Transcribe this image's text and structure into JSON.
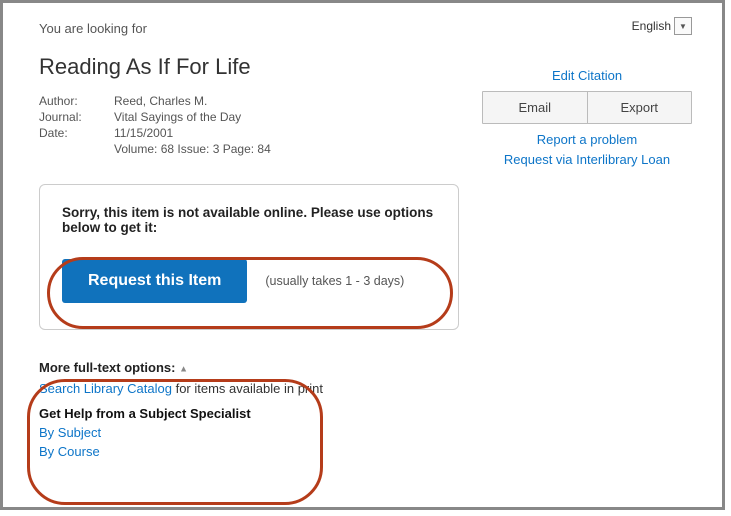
{
  "language": {
    "label": "English"
  },
  "intro": "You are looking for",
  "title": "Reading As If For Life",
  "meta": {
    "author_label": "Author:",
    "author_value": "Reed, Charles M.",
    "journal_label": "Journal:",
    "journal_value": "Vital Sayings of the Day",
    "date_label": "Date:",
    "date_value": "11/15/2001",
    "extra": "Volume: 68   Issue: 3   Page: 84"
  },
  "actions": {
    "edit_citation": "Edit Citation",
    "email": "Email",
    "export": "Export",
    "report_problem": "Report a problem",
    "ill": "Request via Interlibrary Loan"
  },
  "availability": {
    "message": "Sorry, this item is not available online. Please use options below to get it:",
    "request_label": "Request this Item",
    "request_note": "(usually takes 1 - 3 days)"
  },
  "more": {
    "header": "More full-text options:",
    "search_catalog_link": "Search Library Catalog",
    "search_catalog_suffix": " for items available in print",
    "get_help_header": "Get Help from a Subject Specialist",
    "by_subject": "By Subject",
    "by_course": "By Course"
  }
}
